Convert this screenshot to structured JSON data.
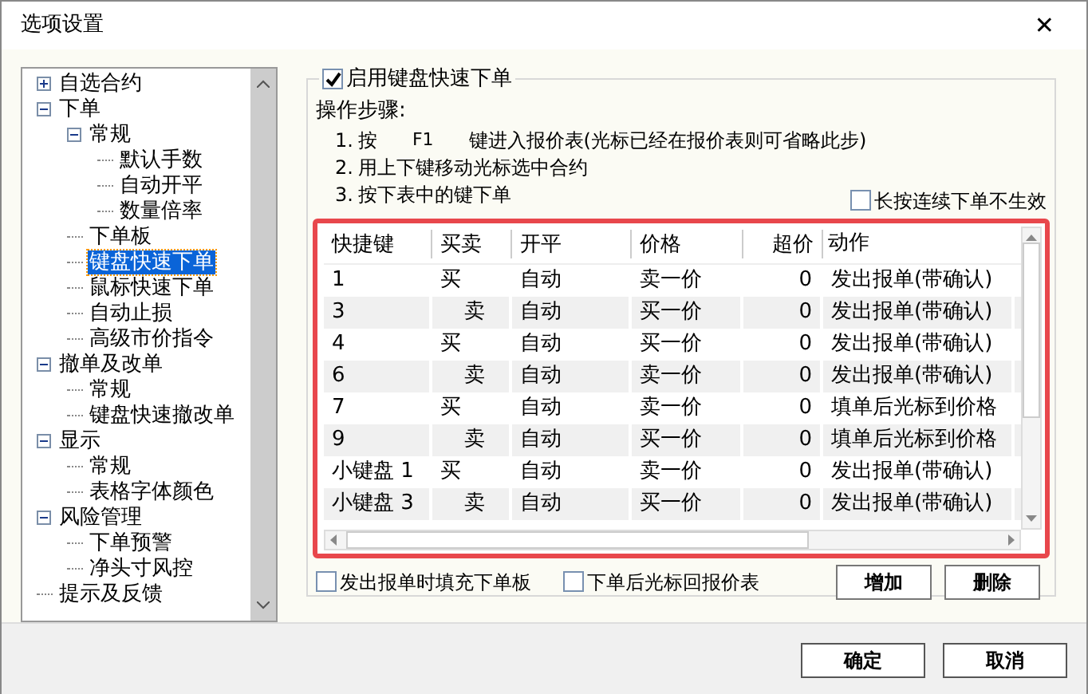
{
  "window": {
    "title": "选项设置",
    "close": "✕"
  },
  "tree": [
    {
      "label": "自选合约",
      "expanded": false,
      "selected": false
    },
    {
      "label": "下单",
      "expanded": true,
      "selected": false,
      "children": [
        {
          "label": "常规",
          "expanded": true,
          "selected": false,
          "children": [
            {
              "label": "默认手数",
              "selected": false
            },
            {
              "label": "自动开平",
              "selected": false
            },
            {
              "label": "数量倍率",
              "selected": false
            }
          ]
        },
        {
          "label": "下单板",
          "selected": false
        },
        {
          "label": "键盘快速下单",
          "selected": true
        },
        {
          "label": "鼠标快速下单",
          "selected": false
        },
        {
          "label": "自动止损",
          "selected": false
        },
        {
          "label": "高级市价指令",
          "selected": false
        }
      ]
    },
    {
      "label": "撤单及改单",
      "expanded": true,
      "selected": false,
      "children": [
        {
          "label": "常规",
          "selected": false
        },
        {
          "label": "键盘快速撤改单",
          "selected": false
        }
      ]
    },
    {
      "label": "显示",
      "expanded": true,
      "selected": false,
      "children": [
        {
          "label": "常规",
          "selected": false
        },
        {
          "label": "表格字体颜色",
          "selected": false
        }
      ]
    },
    {
      "label": "风险管理",
      "expanded": true,
      "selected": false,
      "children": [
        {
          "label": "下单预警",
          "selected": false
        },
        {
          "label": "净头寸风控",
          "selected": false
        }
      ]
    },
    {
      "label": "提示及反馈",
      "selected": false
    }
  ],
  "enable": {
    "label": "启用键盘快速下单",
    "checked": true
  },
  "steps_title": "操作步骤:",
  "steps": [
    {
      "num": "1.",
      "text": "按",
      "key": "F1",
      "rest": "键进入报价表(光标已经在报价表则可省略此步)"
    },
    {
      "num": "2.",
      "text": "用上下键移动光标选中合约"
    },
    {
      "num": "3.",
      "text": "按下表中的键下单"
    }
  ],
  "long_press": {
    "label": "长按连续下单不生效",
    "checked": false
  },
  "table": {
    "columns": [
      "快捷键",
      "买卖",
      "开平",
      "价格",
      "超价",
      "动作"
    ],
    "rows": [
      {
        "cells": [
          "1",
          "买",
          "自动",
          "卖一价",
          "0",
          "发出报单(带确认)"
        ],
        "kind": "buy"
      },
      {
        "cells": [
          "3",
          "卖",
          "自动",
          "买一价",
          "0",
          "发出报单(带确认)"
        ],
        "kind": "sell"
      },
      {
        "cells": [
          "4",
          "买",
          "自动",
          "买一价",
          "0",
          "发出报单(带确认)"
        ],
        "kind": "buy"
      },
      {
        "cells": [
          "6",
          "卖",
          "自动",
          "卖一价",
          "0",
          "发出报单(带确认)"
        ],
        "kind": "sell"
      },
      {
        "cells": [
          "7",
          "买",
          "自动",
          "卖一价",
          "0",
          "填单后光标到价格"
        ],
        "kind": "buy"
      },
      {
        "cells": [
          "9",
          "卖",
          "自动",
          "买一价",
          "0",
          "填单后光标到价格"
        ],
        "kind": "sell"
      },
      {
        "cells": [
          "小键盘 1",
          "买",
          "自动",
          "卖一价",
          "0",
          "发出报单(带确认)"
        ],
        "kind": "buy"
      },
      {
        "cells": [
          "小键盘 3",
          "卖",
          "自动",
          "买一价",
          "0",
          "发出报单(带确认)"
        ],
        "kind": "sell"
      }
    ]
  },
  "options": [
    {
      "label": "发出报单时填充下单板",
      "checked": false
    },
    {
      "label": "下单后光标回报价表",
      "checked": false
    }
  ],
  "table_buttons": [
    "增加",
    "删除"
  ],
  "dialog_buttons": [
    "确定",
    "取消"
  ]
}
